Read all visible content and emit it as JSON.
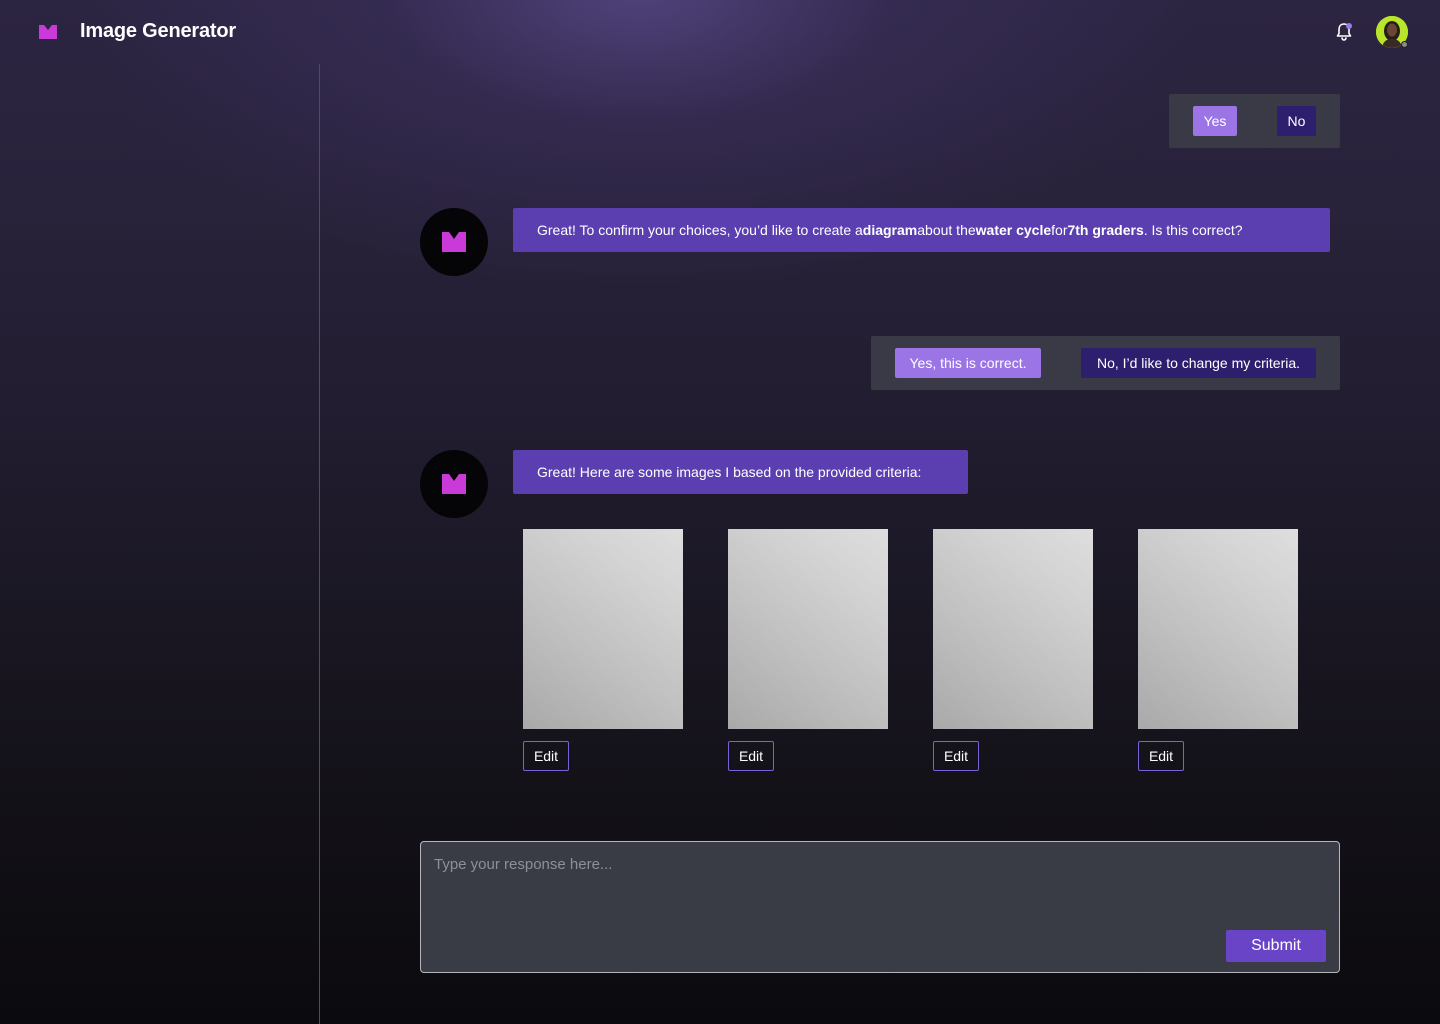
{
  "header": {
    "app_title": "Image Generator",
    "logo_icon": "m-logo-icon",
    "notification_icon": "bell-icon",
    "user_avatar": "avatar"
  },
  "colors": {
    "accent": "#5b3fb0",
    "accent_light": "#9b75e6",
    "accent_dark": "#2e1f6e",
    "logo_magenta": "#c93ad8",
    "divider": "#4a42a0"
  },
  "chat": {
    "first_options": {
      "yes_label": "Yes",
      "no_label": "No"
    },
    "confirm_message": {
      "prefix": "Great! To confirm your choices, you’d like to create a ",
      "type": "diagram",
      "middle1": " about the ",
      "topic": "water cycle",
      "middle2": " for ",
      "audience": "7th graders",
      "suffix": ". Is this correct?"
    },
    "confirm_options": {
      "yes_label": "Yes, this is correct.",
      "no_label": "No, I’d like to change my criteria."
    },
    "results_message": "Great! Here are some images I based on the provided criteria:",
    "images": [
      {
        "edit_label": "Edit"
      },
      {
        "edit_label": "Edit"
      },
      {
        "edit_label": "Edit"
      },
      {
        "edit_label": "Edit"
      }
    ]
  },
  "composer": {
    "placeholder": "Type your response here...",
    "submit_label": "Submit"
  }
}
